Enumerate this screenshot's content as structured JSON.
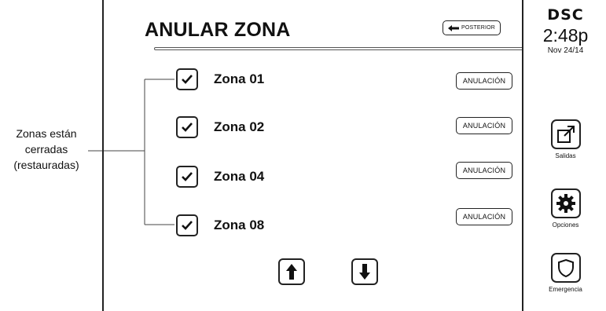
{
  "annotation": {
    "lines": [
      "Zonas están",
      "cerradas",
      "(restauradas)"
    ]
  },
  "header": {
    "title": "ANULAR ZONA",
    "back_label": "POSTERIOR"
  },
  "zones": [
    {
      "label": "Zona 01",
      "checked": true,
      "bypass_label": "ANULACIÓN"
    },
    {
      "label": "Zona 02",
      "checked": true,
      "bypass_label": "ANULACIÓN"
    },
    {
      "label": "Zona 04",
      "checked": true,
      "bypass_label": "ANULACIÓN"
    },
    {
      "label": "Zona 08",
      "checked": true,
      "bypass_label": "ANULACIÓN"
    }
  ],
  "sidebar": {
    "logo": "DSC",
    "time": "2:48p",
    "date": "Nov 24/14",
    "buttons": [
      {
        "label": "Salidas",
        "icon": "exit-icon"
      },
      {
        "label": "Opciones",
        "icon": "options-icon"
      },
      {
        "label": "Emergencia",
        "icon": "emergency-icon"
      }
    ]
  },
  "nav": {
    "up_icon": "arrow-up-icon",
    "down_icon": "arrow-down-icon"
  }
}
